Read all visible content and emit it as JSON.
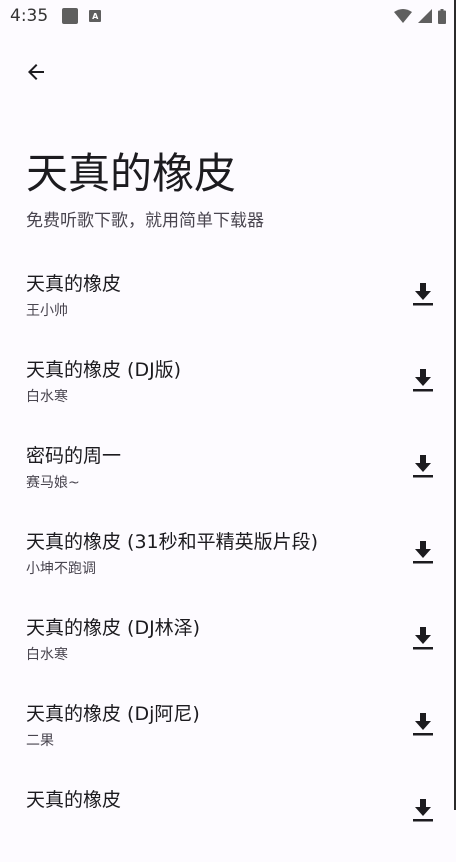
{
  "status": {
    "time": "4:35",
    "badge": "A"
  },
  "header": {
    "title": "天真的橡皮",
    "subtitle": "免费听歌下歌，就用简单下载器"
  },
  "songs": [
    {
      "title": "天真的橡皮",
      "artist": "王小帅"
    },
    {
      "title": "天真的橡皮 (DJ版)",
      "artist": "白水寒"
    },
    {
      "title": "密码的周一",
      "artist": "赛马娘~"
    },
    {
      "title": "天真的橡皮 (31秒和平精英版片段)",
      "artist": "小坤不跑调"
    },
    {
      "title": "天真的橡皮 (DJ林泽)",
      "artist": "白水寒"
    },
    {
      "title": "天真的橡皮 (Dj阿尼)",
      "artist": "二果"
    },
    {
      "title": "天真的橡皮",
      "artist": ""
    }
  ],
  "icons": {
    "back": "arrow-back-icon",
    "download": "download-icon"
  }
}
